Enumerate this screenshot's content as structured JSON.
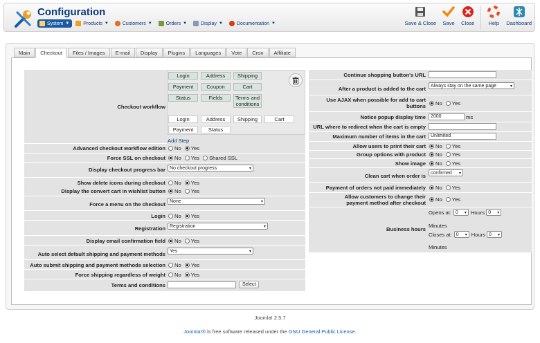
{
  "app": {
    "title": "Configuration"
  },
  "menu": [
    {
      "label": "System",
      "icon": "system-icon",
      "selected": true,
      "color": "#1b5aa3"
    },
    {
      "label": "Products",
      "icon": "products-icon",
      "color": "#f0a020"
    },
    {
      "label": "Customers",
      "icon": "customers-icon",
      "color": "#e06a2a"
    },
    {
      "label": "Orders",
      "icon": "orders-icon",
      "color": "#7a9b3a"
    },
    {
      "label": "Display",
      "icon": "display-icon",
      "color": "#6a7aa0"
    },
    {
      "label": "Documentation",
      "icon": "documentation-icon",
      "color": "#d0401b"
    }
  ],
  "toolbar": {
    "save_close": "Save & Close",
    "save": "Save",
    "close": "Close",
    "help": "Help",
    "dashboard": "Dashboard"
  },
  "tabs": [
    "Main",
    "Checkout",
    "Files / Images",
    "E-mail",
    "Display",
    "Plugins",
    "Languages",
    "Vote",
    "Cron",
    "Affiliate"
  ],
  "active_tab": "Checkout",
  "workflow": {
    "label": "Checkout workflow",
    "row1": [
      "Login",
      "Address",
      "Shipping"
    ],
    "row2": [
      "Payment",
      "Coupon",
      "Cart"
    ],
    "row3": [
      "Status",
      "Fields",
      "Terms and conditions"
    ],
    "row4": [
      "Login",
      "Address",
      "Shipping",
      "Cart"
    ],
    "row5": [
      "Payment",
      "Status"
    ],
    "add_step": "Add Step"
  },
  "radio": {
    "no": "No",
    "yes": "Yes",
    "shared_ssl": "Shared SSL"
  },
  "left": {
    "adv_workflow": "Advanced checkout workflow edition",
    "force_ssl": "Force SSL on checkout",
    "progress_bar": "Display checkout progress bar",
    "progress_bar_value": "No checkout progress",
    "delete_icons": "Show delete icons during checkout",
    "convert_cart": "Display the convert cart in wishlist button",
    "force_menu": "Force a menu on the checkout",
    "force_menu_value": "None",
    "login": "Login",
    "registration": "Registration",
    "registration_value": "Registration",
    "email_confirm": "Display email confirmation field",
    "auto_shipping": "Auto select default shipping and payment methods",
    "auto_shipping_value": "Yes",
    "auto_submit": "Auto submit shipping and payment methods selection",
    "force_shipping": "Force shipping regardless of weight",
    "terms": "Terms and conditions",
    "select_btn": "Select"
  },
  "right": {
    "continue_url": "Continue shopping button's URL",
    "after_add": "After a product is added to the cart",
    "after_add_value": "Always stay on the same page",
    "ajax": "Use AJAX when possible for add to cart buttons",
    "popup_time": "Notice popup display time",
    "popup_time_value": "2000",
    "popup_unit": "ms",
    "redirect_url": "URL where to redirect when the cart is empty",
    "max_items": "Maximum number of items in the cart",
    "max_items_value": "Unlimited",
    "print_cart": "Allow users to print their cart",
    "group_options": "Group options with product",
    "show_image": "Show image",
    "clean_cart": "Clean cart when order is",
    "clean_cart_value": "confirmed",
    "pay_unpaid": "Payment of orders not paid immediately",
    "change_payment": "Allow customers to change their payment method after checkout",
    "business_hours": "Business hours",
    "opens_at": "Opens at:",
    "closes_at": "Closes at:",
    "hours": "Hours",
    "minutes": "Minutes",
    "zero": "0"
  },
  "footer": {
    "version": "Joomla! 2.5.7",
    "joomla": "Joomla!®",
    "license_pre": " is free software released under the ",
    "license_link": "GNU General Public License",
    "license_post": "."
  }
}
